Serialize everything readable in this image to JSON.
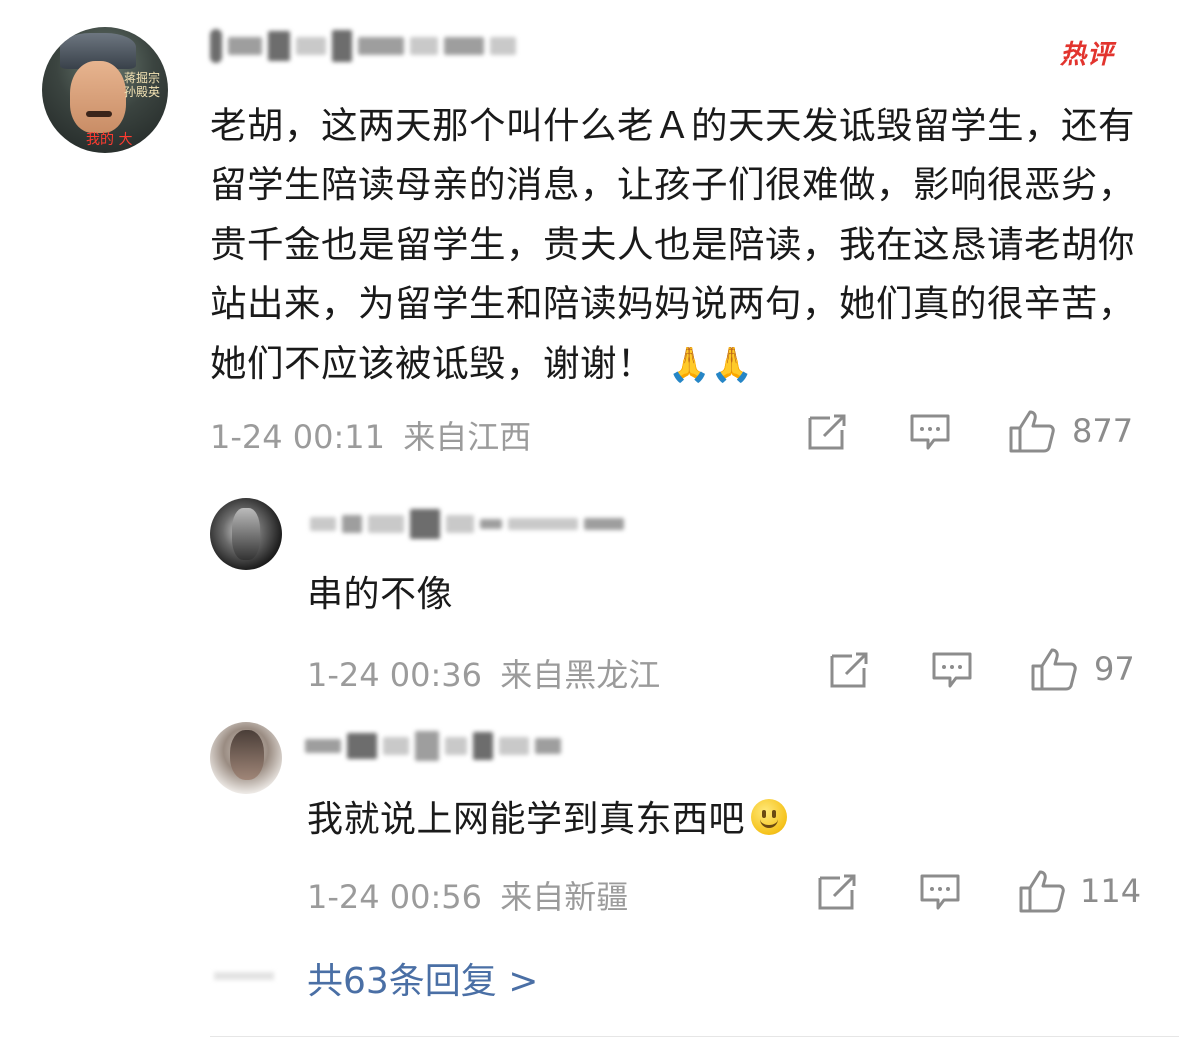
{
  "main_comment": {
    "avatar_text_top": "蒋掘宗\n孙殿英",
    "avatar_text_bottom": "我的 大",
    "hot_badge": "热评",
    "text": "老胡，这两天那个叫什么老Ａ的天天发诋毁留学生，还有留学生陪读母亲的消息，让孩子们很难做，影响很恶劣，贵千金也是留学生，贵夫人也是陪读，我在这恳请老胡你站出来，为留学生和陪读妈妈说两句，她们真的很辛苦，她们不应该被诋毁，谢谢！",
    "emoji": "🙏🙏",
    "time": "1-24 00:11",
    "location": "来自江西",
    "likes": "877"
  },
  "replies": [
    {
      "text": "串的不像",
      "time": "1-24 00:36",
      "location": "来自黑龙江",
      "likes": "97"
    },
    {
      "text": "我就说上网能学到真东西吧",
      "time": "1-24 00:56",
      "location": "来自新疆",
      "likes": "114"
    }
  ],
  "more_replies": "共63条回复 >",
  "icons": {
    "share": "share-icon",
    "comment": "comment-icon",
    "like": "thumbs-up-icon"
  },
  "colors": {
    "hot": "#e2342e",
    "link": "#4a6fa5",
    "meta": "#9b9b9b"
  }
}
